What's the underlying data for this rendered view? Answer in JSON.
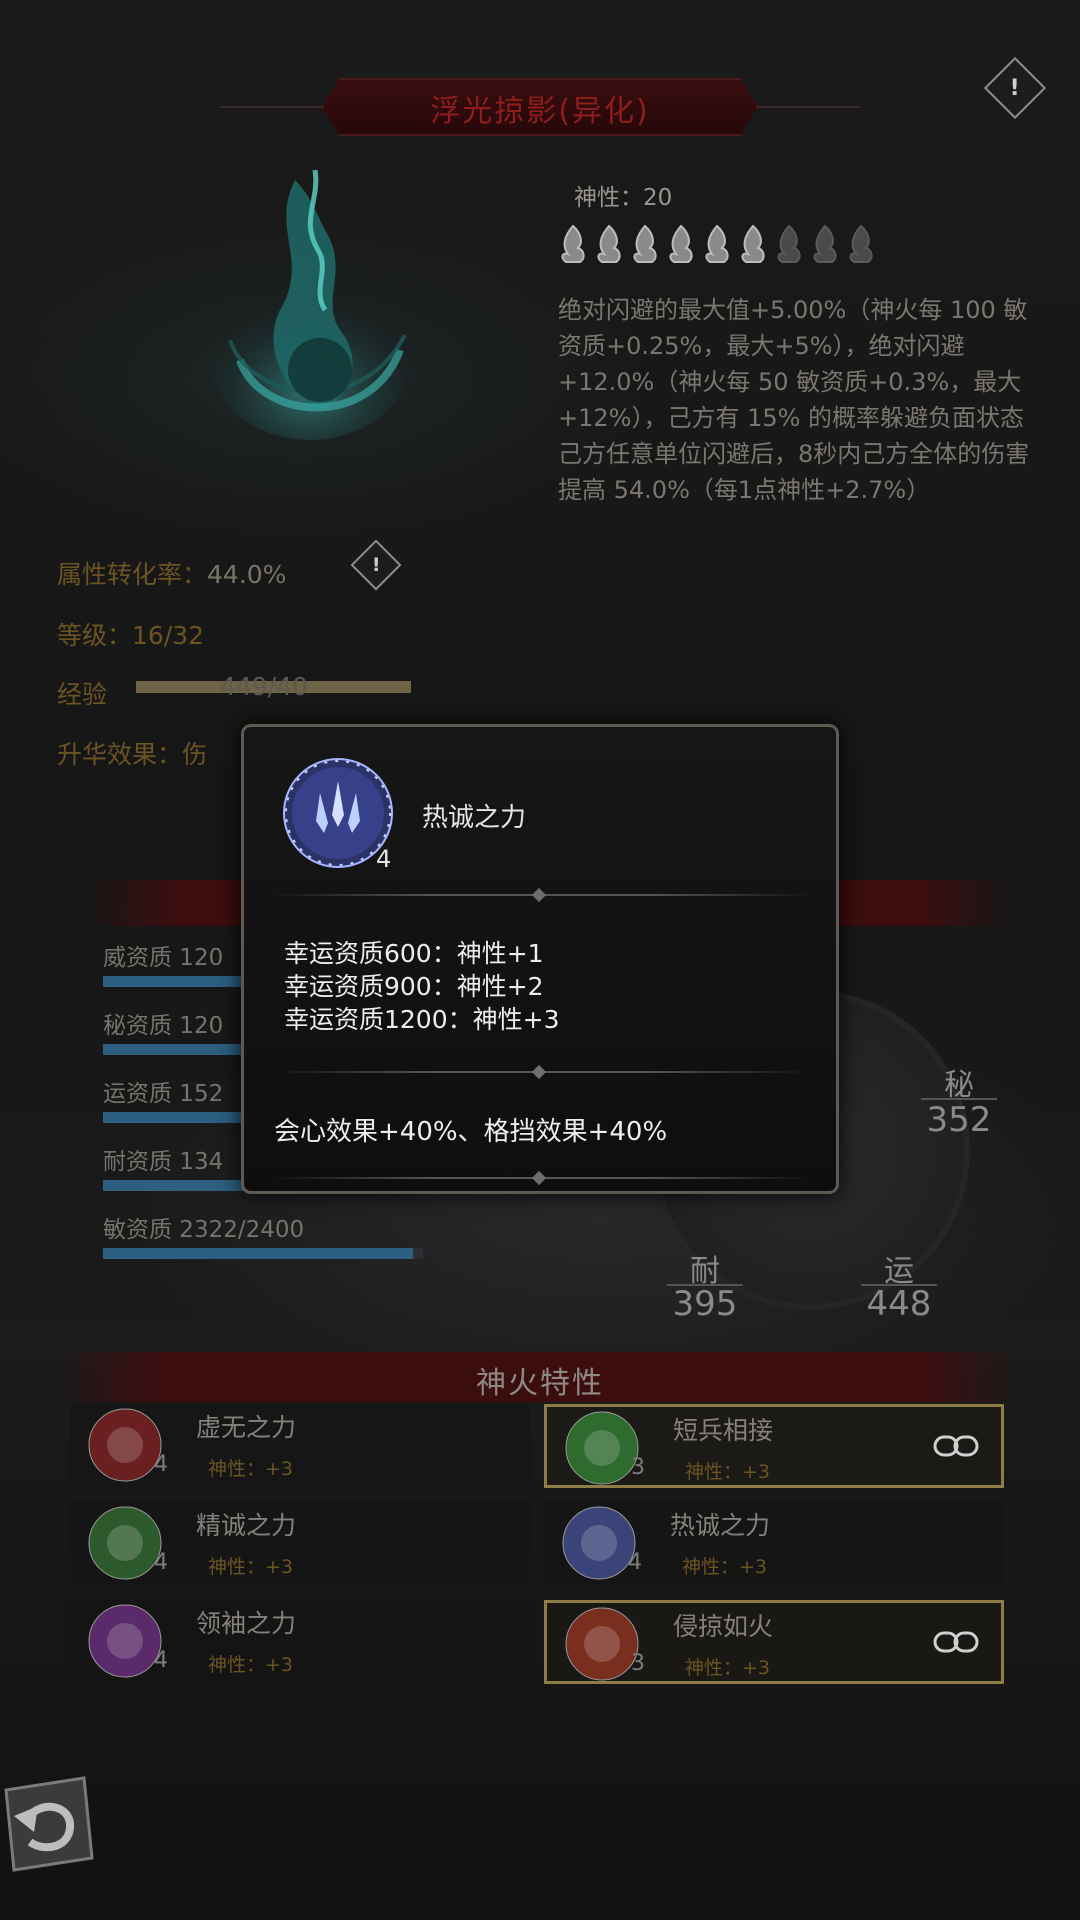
{
  "title": "浮光掠影(异化)",
  "info": {
    "divinity_label": "神性：20",
    "flames_total": 9,
    "flames_lit": 6,
    "description": "绝对闪避的最大值+5.00%（神火每 100 敏资质+0.25%，最大+5%），绝对闪避+12.0%（神火每 50 敏资质+0.3%，最大+12%），己方有 15% 的概率躲避负面状态\n己方任意单位闪避后，8秒内己方全体的伤害提高 54.0%（每1点神性+2.7%）"
  },
  "stats": {
    "conversion_label": "属性转化率：",
    "conversion_value": "44.0%",
    "level_label": "等级：",
    "level_value": "16/32",
    "exp_label": "经验",
    "exp_value": "449/40",
    "exp_progress": 1.0,
    "sublimation_label": "升华效果：伤"
  },
  "aptitudes": [
    {
      "label": "威资质",
      "value": "120",
      "progress": 0.5
    },
    {
      "label": "秘资质",
      "value": "120",
      "progress": 0.5
    },
    {
      "label": "运资质",
      "value": "152",
      "progress": 0.63
    },
    {
      "label": "耐资质",
      "value": "134",
      "progress": 0.56
    },
    {
      "label": "敏资质",
      "value": "2322/2400",
      "progress": 0.97
    }
  ],
  "attributes": {
    "mi_label": "秘",
    "mi_value": "352",
    "nai_label": "耐",
    "nai_value": "395",
    "yun_label": "运",
    "yun_value": "448"
  },
  "traits_header": "神火特性",
  "traits": [
    {
      "name": "虚无之力",
      "level": "4",
      "sub": "神性：+3",
      "linked": false,
      "icon": "void-power-icon",
      "color": "#6a2020"
    },
    {
      "name": "短兵相接",
      "level": "3",
      "sub": "神性：+3",
      "linked": true,
      "icon": "close-combat-icon",
      "color": "#2f6a2f"
    },
    {
      "name": "精诚之力",
      "level": "4",
      "sub": "神性：+3",
      "linked": false,
      "icon": "sincerity-power-icon",
      "color": "#2d5a2d"
    },
    {
      "name": "热诚之力",
      "level": "4",
      "sub": "神性：+3",
      "linked": false,
      "icon": "zeal-power-icon",
      "color": "#3b4478"
    },
    {
      "name": "领袖之力",
      "level": "4",
      "sub": "神性：+3",
      "linked": false,
      "icon": "leader-power-icon",
      "color": "#5a2a6a"
    },
    {
      "name": "侵掠如火",
      "level": "3",
      "sub": "神性：+3",
      "linked": true,
      "icon": "raid-fire-icon",
      "color": "#7a2e20"
    }
  ],
  "modal": {
    "name": "热诚之力",
    "level": "4",
    "requirements": [
      "幸运资质600：神性+1",
      "幸运资质900：神性+2",
      "幸运资质1200：神性+3"
    ],
    "effect": "会心效果+40%、格挡效果+40%"
  },
  "colors": {
    "accent_gold": "#6b5422",
    "title_red": "#8e1e1e",
    "bar_blue": "#2c5f80",
    "link_border": "#8d7c45"
  }
}
